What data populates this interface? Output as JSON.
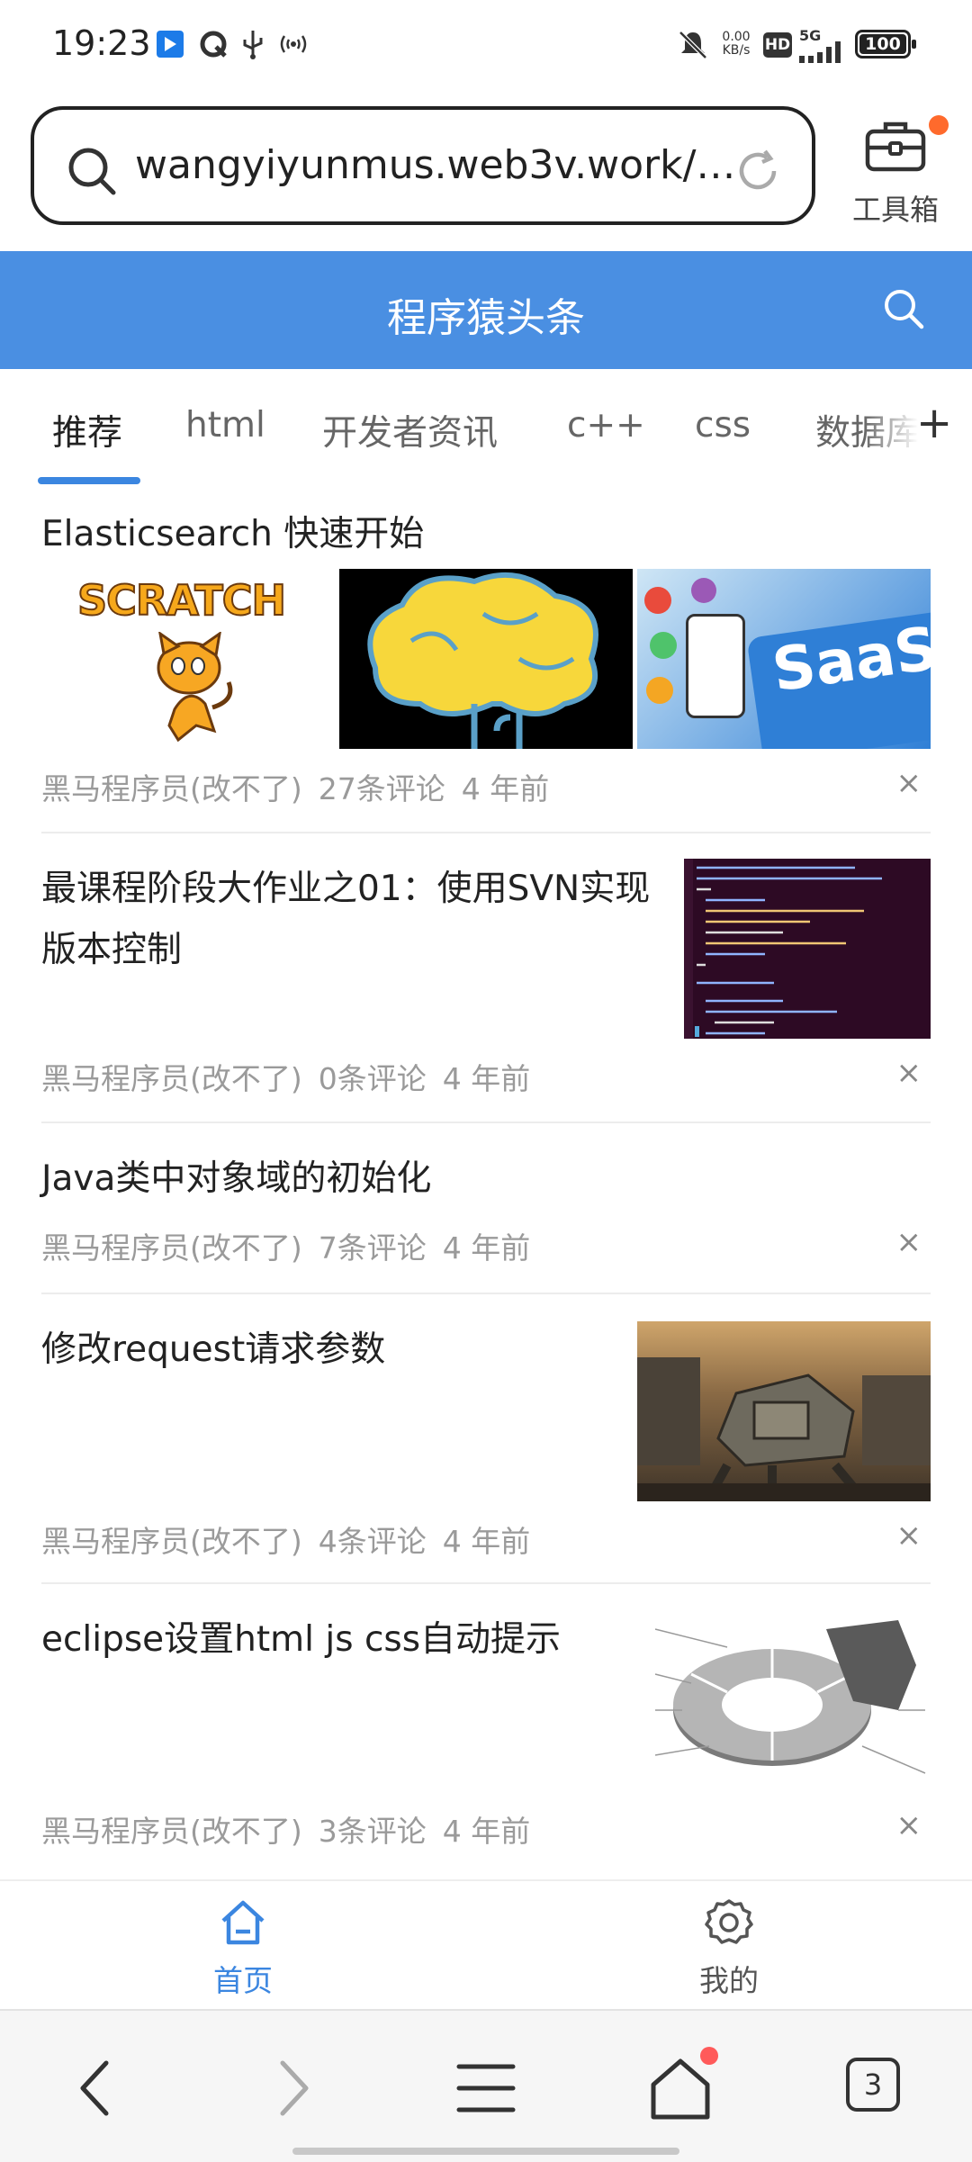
{
  "status_bar": {
    "time": "19:23",
    "net_speed_value": "0.00",
    "net_speed_unit": "KB/s",
    "hd_badge": "HD",
    "network": "5G",
    "battery": "100"
  },
  "browser": {
    "url": "wangyiyunmus.web3v.work/…",
    "toolbox_label": "工具箱"
  },
  "site": {
    "title": "程序猿头条"
  },
  "tabs": [
    {
      "label": "推荐"
    },
    {
      "label": "html"
    },
    {
      "label": "开发者资讯"
    },
    {
      "label": "c++"
    },
    {
      "label": "css"
    },
    {
      "label": "数据库"
    }
  ],
  "add_tab_symbol": "+",
  "articles": [
    {
      "title": "Elasticsearch 快速开始",
      "author": "黑马程序员(改不了)",
      "comments": "27条评论",
      "time": "4 年前"
    },
    {
      "title": "最课程阶段大作业之01：使用SVN实现版本控制",
      "author": "黑马程序员(改不了)",
      "comments": "0条评论",
      "time": "4 年前"
    },
    {
      "title": "Java类中对象域的初始化",
      "author": "黑马程序员(改不了)",
      "comments": "7条评论",
      "time": "4 年前"
    },
    {
      "title": "修改request请求参数",
      "author": "黑马程序员(改不了)",
      "comments": "4条评论",
      "time": "4 年前"
    },
    {
      "title": "eclipse设置html js css自动提示",
      "author": "黑马程序员(改不了)",
      "comments": "3条评论",
      "time": "4 年前"
    }
  ],
  "thumb_text": {
    "scratch": "SCRATCH",
    "saas": "SaaS"
  },
  "close_symbol": "×",
  "app_nav": {
    "home": "首页",
    "mine": "我的"
  },
  "browser_bar": {
    "tab_count": "3"
  },
  "colors": {
    "header_blue": "#4a8fe2",
    "accent_blue": "#3b86e0",
    "badge_orange": "#ff6a2c"
  }
}
